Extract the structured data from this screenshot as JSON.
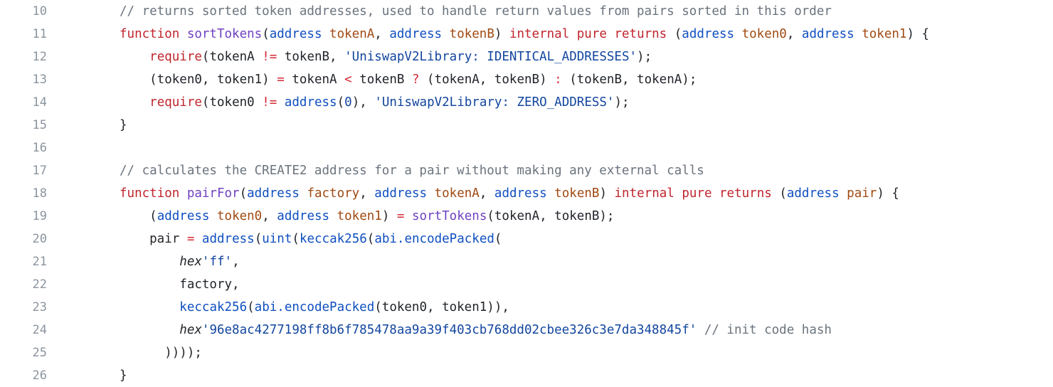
{
  "editor": {
    "language": "solidity",
    "background_color": "#ffffff",
    "gutter_color": "#8b949e",
    "first_line_number": 10,
    "last_line_number": 26,
    "line_height_px": 32
  },
  "theme": {
    "comment": "#6a737d",
    "keyword": "#c0252d",
    "operator": "#d42b35",
    "type": "#0f4fc0",
    "string": "#12459e",
    "function_name": "#6f42c1",
    "parameter": "#a04a12",
    "plain_text": "#1f2328"
  },
  "lines": [
    {
      "number": "10",
      "tokens": [
        {
          "text": "// returns sorted token addresses, used to handle return values from pairs sorted in this order",
          "kind": "comment"
        }
      ]
    },
    {
      "number": "11",
      "tokens": [
        {
          "text": "function ",
          "kind": "keyword"
        },
        {
          "text": "sortTokens",
          "kind": "func"
        },
        {
          "text": "(",
          "kind": "punct"
        },
        {
          "text": "address",
          "kind": "type"
        },
        {
          "text": " ",
          "kind": "plain"
        },
        {
          "text": "tokenA",
          "kind": "param"
        },
        {
          "text": ", ",
          "kind": "punct"
        },
        {
          "text": "address",
          "kind": "type"
        },
        {
          "text": " ",
          "kind": "plain"
        },
        {
          "text": "tokenB",
          "kind": "param"
        },
        {
          "text": ") ",
          "kind": "punct"
        },
        {
          "text": "internal pure returns",
          "kind": "keyword"
        },
        {
          "text": " (",
          "kind": "punct"
        },
        {
          "text": "address",
          "kind": "type"
        },
        {
          "text": " ",
          "kind": "plain"
        },
        {
          "text": "token0",
          "kind": "param"
        },
        {
          "text": ", ",
          "kind": "punct"
        },
        {
          "text": "address",
          "kind": "type"
        },
        {
          "text": " ",
          "kind": "plain"
        },
        {
          "text": "token1",
          "kind": "param"
        },
        {
          "text": ") {",
          "kind": "punct"
        }
      ]
    },
    {
      "number": "12",
      "tokens": [
        {
          "text": "    ",
          "kind": "plain"
        },
        {
          "text": "require",
          "kind": "keyword"
        },
        {
          "text": "(tokenA ",
          "kind": "plain"
        },
        {
          "text": "!=",
          "kind": "operator"
        },
        {
          "text": " tokenB, ",
          "kind": "plain"
        },
        {
          "text": "'UniswapV2Library: IDENTICAL_ADDRESSES'",
          "kind": "string"
        },
        {
          "text": ");",
          "kind": "punct"
        }
      ]
    },
    {
      "number": "13",
      "tokens": [
        {
          "text": "    (token0, token1) ",
          "kind": "plain"
        },
        {
          "text": "=",
          "kind": "operator"
        },
        {
          "text": " tokenA ",
          "kind": "plain"
        },
        {
          "text": "<",
          "kind": "operator"
        },
        {
          "text": " tokenB ",
          "kind": "plain"
        },
        {
          "text": "?",
          "kind": "operator"
        },
        {
          "text": " (tokenA, tokenB) ",
          "kind": "plain"
        },
        {
          "text": ":",
          "kind": "operator"
        },
        {
          "text": " (tokenB, tokenA);",
          "kind": "plain"
        }
      ]
    },
    {
      "number": "14",
      "tokens": [
        {
          "text": "    ",
          "kind": "plain"
        },
        {
          "text": "require",
          "kind": "keyword"
        },
        {
          "text": "(token0 ",
          "kind": "plain"
        },
        {
          "text": "!=",
          "kind": "operator"
        },
        {
          "text": " ",
          "kind": "plain"
        },
        {
          "text": "address",
          "kind": "type"
        },
        {
          "text": "(",
          "kind": "punct"
        },
        {
          "text": "0",
          "kind": "number"
        },
        {
          "text": "), ",
          "kind": "punct"
        },
        {
          "text": "'UniswapV2Library: ZERO_ADDRESS'",
          "kind": "string"
        },
        {
          "text": ");",
          "kind": "punct"
        }
      ]
    },
    {
      "number": "15",
      "tokens": [
        {
          "text": "}",
          "kind": "plain"
        }
      ]
    },
    {
      "number": "16",
      "tokens": []
    },
    {
      "number": "17",
      "tokens": [
        {
          "text": "// calculates the CREATE2 address for a pair without making any external calls",
          "kind": "comment"
        }
      ]
    },
    {
      "number": "18",
      "tokens": [
        {
          "text": "function ",
          "kind": "keyword"
        },
        {
          "text": "pairFor",
          "kind": "func"
        },
        {
          "text": "(",
          "kind": "punct"
        },
        {
          "text": "address",
          "kind": "type"
        },
        {
          "text": " ",
          "kind": "plain"
        },
        {
          "text": "factory",
          "kind": "param"
        },
        {
          "text": ", ",
          "kind": "punct"
        },
        {
          "text": "address",
          "kind": "type"
        },
        {
          "text": " ",
          "kind": "plain"
        },
        {
          "text": "tokenA",
          "kind": "param"
        },
        {
          "text": ", ",
          "kind": "punct"
        },
        {
          "text": "address",
          "kind": "type"
        },
        {
          "text": " ",
          "kind": "plain"
        },
        {
          "text": "tokenB",
          "kind": "param"
        },
        {
          "text": ") ",
          "kind": "punct"
        },
        {
          "text": "internal pure returns",
          "kind": "keyword"
        },
        {
          "text": " (",
          "kind": "punct"
        },
        {
          "text": "address",
          "kind": "type"
        },
        {
          "text": " ",
          "kind": "plain"
        },
        {
          "text": "pair",
          "kind": "param"
        },
        {
          "text": ") {",
          "kind": "punct"
        }
      ]
    },
    {
      "number": "19",
      "tokens": [
        {
          "text": "    (",
          "kind": "punct"
        },
        {
          "text": "address",
          "kind": "type"
        },
        {
          "text": " ",
          "kind": "plain"
        },
        {
          "text": "token0",
          "kind": "param"
        },
        {
          "text": ", ",
          "kind": "punct"
        },
        {
          "text": "address",
          "kind": "type"
        },
        {
          "text": " ",
          "kind": "plain"
        },
        {
          "text": "token1",
          "kind": "param"
        },
        {
          "text": ") ",
          "kind": "punct"
        },
        {
          "text": "=",
          "kind": "operator"
        },
        {
          "text": " ",
          "kind": "plain"
        },
        {
          "text": "sortTokens",
          "kind": "func"
        },
        {
          "text": "(tokenA, tokenB);",
          "kind": "plain"
        }
      ]
    },
    {
      "number": "20",
      "tokens": [
        {
          "text": "    pair ",
          "kind": "plain"
        },
        {
          "text": "=",
          "kind": "operator"
        },
        {
          "text": " ",
          "kind": "plain"
        },
        {
          "text": "address",
          "kind": "type"
        },
        {
          "text": "(",
          "kind": "punct"
        },
        {
          "text": "uint",
          "kind": "type"
        },
        {
          "text": "(",
          "kind": "punct"
        },
        {
          "text": "keccak256",
          "kind": "builtin"
        },
        {
          "text": "(",
          "kind": "punct"
        },
        {
          "text": "abi.encodePacked",
          "kind": "builtin"
        },
        {
          "text": "(",
          "kind": "punct"
        }
      ]
    },
    {
      "number": "21",
      "tokens": [
        {
          "text": "        ",
          "kind": "plain"
        },
        {
          "text": "hex",
          "kind": "hexkw"
        },
        {
          "text": "'ff'",
          "kind": "string"
        },
        {
          "text": ",",
          "kind": "punct"
        }
      ]
    },
    {
      "number": "22",
      "tokens": [
        {
          "text": "        factory,",
          "kind": "plain"
        }
      ]
    },
    {
      "number": "23",
      "tokens": [
        {
          "text": "        ",
          "kind": "plain"
        },
        {
          "text": "keccak256",
          "kind": "builtin"
        },
        {
          "text": "(",
          "kind": "punct"
        },
        {
          "text": "abi.encodePacked",
          "kind": "builtin"
        },
        {
          "text": "(token0, token1)),",
          "kind": "plain"
        }
      ]
    },
    {
      "number": "24",
      "tokens": [
        {
          "text": "        ",
          "kind": "plain"
        },
        {
          "text": "hex",
          "kind": "hexkw"
        },
        {
          "text": "'96e8ac4277198ff8b6f785478aa9a39f403cb768dd02cbee326c3e7da348845f'",
          "kind": "string"
        },
        {
          "text": " ",
          "kind": "plain"
        },
        {
          "text": "// init code hash",
          "kind": "comment"
        }
      ]
    },
    {
      "number": "25",
      "tokens": [
        {
          "text": "      ))));",
          "kind": "plain"
        }
      ]
    },
    {
      "number": "26",
      "tokens": [
        {
          "text": "}",
          "kind": "plain"
        }
      ]
    }
  ]
}
